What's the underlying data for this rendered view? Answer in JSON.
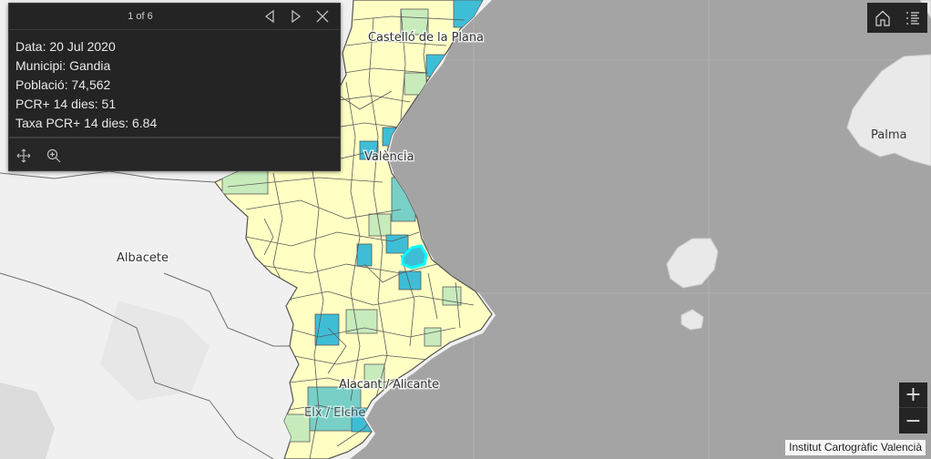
{
  "popup": {
    "page_count": "1 of 6",
    "fields": [
      "Data: 20 Jul 2020",
      "Municipi: Gandia",
      "Població: 74,562",
      "PCR+ 14 dies: 51",
      "Taxa PCR+ 14 dies: 6.84"
    ],
    "icons": {
      "previous": "triangle-left-icon",
      "next": "triangle-right-icon",
      "close": "close-icon",
      "pan": "move-arrows-icon",
      "zoom": "zoom-in-icon"
    }
  },
  "map": {
    "labels": {
      "albacete": "Albacete",
      "palma": "Palma",
      "valencia": "València",
      "castello": "Castelló de la Plana",
      "alacant": "Alacant / Alicante",
      "elx": "Elx / Elche"
    },
    "colors": {
      "sea": "#a4a4a4",
      "land": "#f0f0f0",
      "balearic": "#e9e9e9",
      "choropleth_low": "#ffffc4",
      "choropleth_mid": "#c8ebbc",
      "choropleth_high": "#78cfc6",
      "choropleth_top": "#3ebed6",
      "selection": "#00ffff"
    },
    "selected_municipality": "Gandia"
  },
  "toolbar": {
    "icons": {
      "home": "home-icon",
      "legend": "list-icon"
    }
  },
  "zoom": {
    "in_label": "+",
    "out_label": "−"
  },
  "attribution": "Institut Cartogràfic Valencià"
}
